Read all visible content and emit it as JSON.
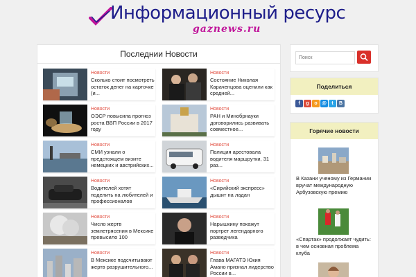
{
  "site": {
    "title": "Информационный ресурс",
    "subtitle": "gaznews.ru"
  },
  "main": {
    "heading": "Последнии Новости",
    "cards": [
      {
        "category": "Новости",
        "title": "Сколько стоит посмотреть остаток денег на карточке (и...",
        "icon": "atm-photo"
      },
      {
        "category": "Новости",
        "title": "Состояние Николая Караченцова оценили как средней...",
        "icon": "people-photo"
      },
      {
        "category": "Новости",
        "title": "ОЭСР повысила прогноз роста ВВП России в 2017 году",
        "icon": "money-photo"
      },
      {
        "category": "Новости",
        "title": "РАН и Минобрнауки договорились развивать совместное...",
        "icon": "building-photo"
      },
      {
        "category": "Новости",
        "title": "СМИ узнали о предстоящем визите немецких и австрийских...",
        "icon": "sea-photo"
      },
      {
        "category": "Новости",
        "title": "Полиция арестовала водителя маршрутки, 31 раз...",
        "icon": "van-photo"
      },
      {
        "category": "Новости",
        "title": "Водителей хотят поделить на любителей и профессионалов",
        "icon": "car-photo"
      },
      {
        "category": "Новости",
        "title": "«Сирийский экспресс» дышит на ладан",
        "icon": "ship-photo"
      },
      {
        "category": "Новости",
        "title": "Число жертв землетрясения в Мексике превысило 100",
        "icon": "smoke-photo"
      },
      {
        "category": "Новости",
        "title": "Нарышкину покажут портрет легендарного разведчика",
        "icon": "portrait-photo"
      },
      {
        "category": "Новости",
        "title": "В Мексике подсчитывают жертв разрушительного...",
        "icon": "city-photo"
      },
      {
        "category": "Новости",
        "title": "Глава МАГАТЭ Юкия Амано признал лидерство России в...",
        "icon": "officials-photo"
      }
    ]
  },
  "sidebar": {
    "search": {
      "placeholder": "Поиск"
    },
    "share": {
      "heading": "Поделиться",
      "icons": [
        {
          "name": "facebook-icon",
          "glyph": "f",
          "color": "#3b5998"
        },
        {
          "name": "google-plus-icon",
          "glyph": "g",
          "color": "#dd4b39"
        },
        {
          "name": "odnoklassniki-icon",
          "glyph": "о",
          "color": "#f59a20"
        },
        {
          "name": "mailru-icon",
          "glyph": "@",
          "color": "#168de2"
        },
        {
          "name": "twitter-icon",
          "glyph": "t",
          "color": "#2aa3e6"
        },
        {
          "name": "vk-icon",
          "glyph": "В",
          "color": "#4c75a3"
        }
      ]
    },
    "hot": {
      "heading": "Горячие новости",
      "items": [
        {
          "title": "В Казани ученому из Германии вручат международную Арбузовскую премию"
        },
        {
          "title": "«Спартак» продолжает чудить: в чем основная проблема клуба"
        },
        {
          "title": ""
        }
      ]
    }
  },
  "colors": {
    "accent": "#e0483a",
    "search_button": "#d9302a",
    "widget_header": "#f2f0c0",
    "logo_blue": "#1e1e8a",
    "logo_pink": "#c0149a"
  }
}
